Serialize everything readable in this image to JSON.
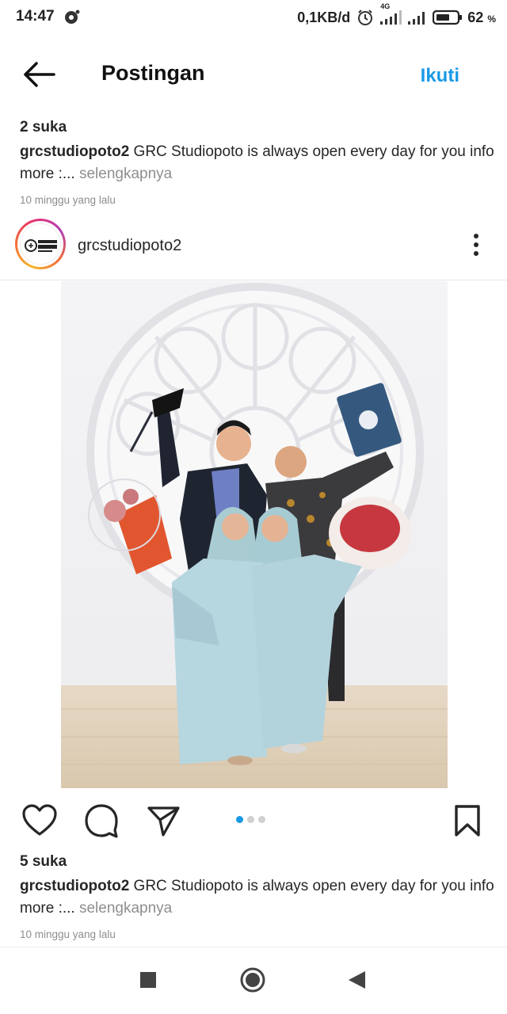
{
  "status_bar": {
    "time": "14:47",
    "net_speed": "0,1KB/d",
    "network_type": "4G",
    "battery_percent": "62",
    "battery_unit": "%",
    "icons": [
      "notification-icon",
      "alarm-icon",
      "signal-4g-icon",
      "signal-icon",
      "battery-icon"
    ]
  },
  "header": {
    "title": "Postingan",
    "follow_label": "Ikuti",
    "back_icon": "arrow-left-icon"
  },
  "previous_post": {
    "likes": "2 suka",
    "caption_author": "grcstudiopoto2",
    "caption_text": " GRC Studiopoto is always open every day for you info more :...",
    "more_label": " selengkapnya",
    "timestamp": "10 minggu yang lalu"
  },
  "post": {
    "username": "grcstudiopoto2",
    "avatar_text": "STUDIOPOTO",
    "likes": "5 suka",
    "caption_author": "grcstudiopoto2",
    "caption_text": " GRC Studiopoto is always open every day for you info more :...",
    "more_label": " selengkapnya",
    "timestamp": "10 minggu yang lalu",
    "carousel_total": 3,
    "carousel_index": 1,
    "accent_color": "#1a9ae6"
  },
  "actions": {
    "icons": [
      "heart-icon",
      "comment-icon",
      "send-icon",
      "bookmark-icon"
    ]
  },
  "nav_bar": {
    "icons": [
      "recents-square-icon",
      "home-circle-icon",
      "back-triangle-icon"
    ]
  }
}
